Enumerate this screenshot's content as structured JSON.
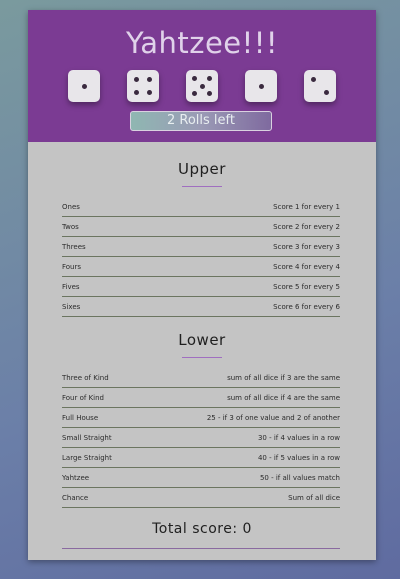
{
  "header": {
    "title": "Yahtzee!!!",
    "dice": [
      1,
      4,
      5,
      1,
      2
    ],
    "rolls_label": "2 Rolls left"
  },
  "upper": {
    "title": "Upper",
    "rows": [
      {
        "name": "Ones",
        "desc": "Score 1 for every 1"
      },
      {
        "name": "Twos",
        "desc": "Score 2 for every 2"
      },
      {
        "name": "Threes",
        "desc": "Score 3 for every 3"
      },
      {
        "name": "Fours",
        "desc": "Score 4 for every 4"
      },
      {
        "name": "Fives",
        "desc": "Score 5 for every 5"
      },
      {
        "name": "Sixes",
        "desc": "Score 6 for every 6"
      }
    ]
  },
  "lower": {
    "title": "Lower",
    "rows": [
      {
        "name": "Three of Kind",
        "desc": "sum of all dice if 3 are the same"
      },
      {
        "name": "Four of Kind",
        "desc": "sum of all dice if 4 are the same"
      },
      {
        "name": "Full House",
        "desc": "25 - if 3 of one value and 2 of another"
      },
      {
        "name": "Small Straight",
        "desc": "30 - if 4 values in a row"
      },
      {
        "name": "Large Straight",
        "desc": "40 - if 5 values in a row"
      },
      {
        "name": "Yahtzee",
        "desc": "50 - if all values match"
      },
      {
        "name": "Chance",
        "desc": "Sum of all dice"
      }
    ]
  },
  "total": {
    "label": "Total score: 0"
  },
  "colors": {
    "header_bg": "#7b3b93",
    "card_bg": "#c4c4c4",
    "die_face": "#e8e6ea",
    "pip": "#3a2a3f",
    "accent_underline": "#a06fc0"
  }
}
